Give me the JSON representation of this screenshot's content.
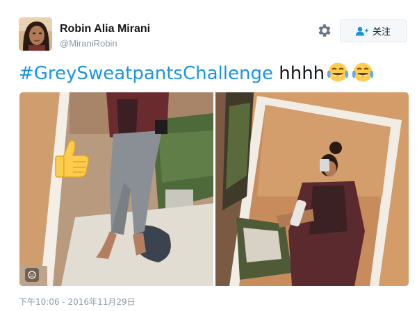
{
  "user": {
    "name": "Robin Alia Mirani",
    "handle": "@MiraniRobin"
  },
  "actions": {
    "follow_label": "关注",
    "settings_icon": "gear-icon",
    "follow_icon": "add-user-icon"
  },
  "tweet": {
    "hashtag": "#GreySweatpantsChallenge",
    "text": " hhhh",
    "emojis": [
      "face-with-tears-of-joy",
      "face-with-tears-of-joy"
    ]
  },
  "media": {
    "photos": [
      "mirror-photo-left",
      "mirror-photo-right"
    ],
    "stickers": [
      "thumbs-up-emoji"
    ],
    "badge_icon": "sticker-badge-icon"
  },
  "timestamp": "下午10:06 - 2016年11月29日",
  "colors": {
    "link": "#1b95e0",
    "secondary_text": "#8899a6",
    "follow_bg": "#f5f8fa"
  }
}
